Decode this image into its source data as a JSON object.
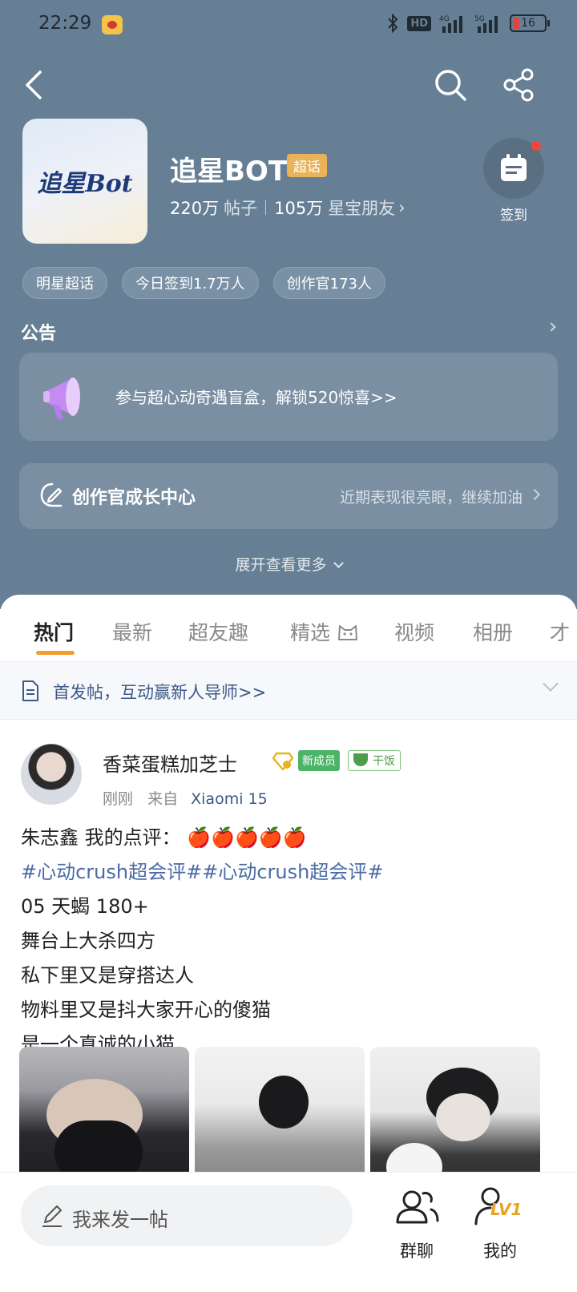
{
  "status": {
    "time": "22:29",
    "hd": "HD",
    "network_1": "4G",
    "network_2": "5G",
    "battery": "16"
  },
  "topic": {
    "avatar_text": "追星Bot",
    "title": "追星BOT",
    "badge": "超话",
    "posts_count": "220万",
    "posts_label": "帖子",
    "friends_count": "105万",
    "friends_label": "星宝朋友",
    "checkin_label": "签到"
  },
  "tags": [
    "明星超话",
    "今日签到1.7万人",
    "创作官173人"
  ],
  "notice": {
    "title": "公告",
    "announcement": "参与超心动奇遇盲盒，解锁520惊喜>>"
  },
  "creator": {
    "title": "创作官成长中心",
    "desc": "近期表现很亮眼，继续加油"
  },
  "expand_label": "展开查看更多",
  "tabs": [
    {
      "label": "热门",
      "active": true
    },
    {
      "label": "最新"
    },
    {
      "label": "超友趣"
    },
    {
      "label": "精选"
    },
    {
      "label": "视频"
    },
    {
      "label": "相册"
    },
    {
      "label": "才"
    }
  ],
  "pinned": {
    "text": "首发帖，互动赢新人导师>>"
  },
  "post": {
    "author": "香菜蛋糕加芝士",
    "member_badge": "新成员",
    "rice_badge": "干饭",
    "time": "刚刚",
    "from": "来自",
    "device": "Xiaomi 15",
    "lines": {
      "l1": "朱志鑫 我的点评：",
      "l1_apples": "🍎🍎🍎🍎🍎",
      "l2": "#心动crush超会评##心动crush超会评#",
      "l3": "05 天蝎 180+",
      "l4": "舞台上大杀四方",
      "l5": "私下里又是穿搭达人",
      "l6": "物料里又是抖大家开心的傻猫",
      "l7": "是一个真诚的小猫"
    }
  },
  "bottom": {
    "compose": "我来发一帖",
    "group_chat": "群聊",
    "mine": "我的",
    "level": "LV1"
  },
  "colors": {
    "header_bg": "#667f95",
    "accent_orange": "#f49b2d",
    "link_blue": "#4b6aa5",
    "badge_gold": "#e9b35a"
  },
  "icons": [
    "back-icon",
    "search-icon",
    "share-icon",
    "calendar-icon",
    "megaphone-icon",
    "creator-icon",
    "document-icon",
    "pen-icon",
    "group-chat-icon",
    "user-icon"
  ]
}
